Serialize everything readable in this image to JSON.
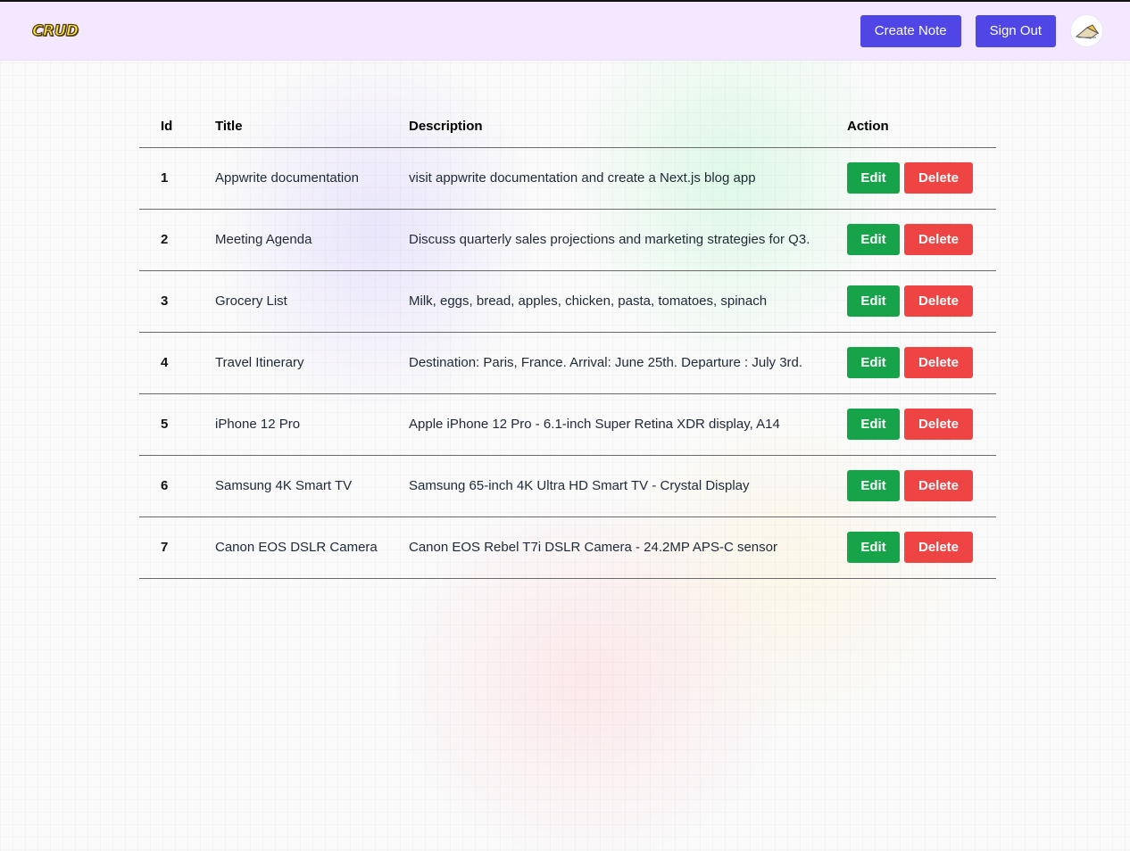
{
  "header": {
    "logo_text": "CRUD",
    "create_note_label": "Create Note",
    "sign_out_label": "Sign Out",
    "avatar_icon": "user-avatar-icon"
  },
  "table": {
    "columns": [
      "Id",
      "Title",
      "Description",
      "Action"
    ],
    "rows": [
      {
        "id": "1",
        "title": "Appwrite documentation",
        "description": "visit appwrite documentation and create a Next.js blog app"
      },
      {
        "id": "2",
        "title": "Meeting Agenda",
        "description": "Discuss quarterly sales projections and marketing strategies for Q3."
      },
      {
        "id": "3",
        "title": "Grocery List",
        "description": "Milk, eggs, bread, apples, chicken, pasta, tomatoes, spinach"
      },
      {
        "id": "4",
        "title": "Travel Itinerary",
        "description": "Destination: Paris, France. Arrival: June 25th. Departure : July 3rd."
      },
      {
        "id": "5",
        "title": "iPhone 12 Pro",
        "description": "Apple iPhone 12 Pro - 6.1-inch Super Retina XDR display, A14"
      },
      {
        "id": "6",
        "title": "Samsung 4K Smart TV",
        "description": "Samsung 65-inch 4K Ultra HD Smart TV - Crystal Display"
      },
      {
        "id": "7",
        "title": "Canon EOS DSLR Camera",
        "description": "Canon EOS Rebel T7i DSLR Camera - 24.2MP APS-C sensor"
      }
    ],
    "edit_label": "Edit",
    "delete_label": "Delete"
  },
  "colors": {
    "header_bg": "#f3e8ff",
    "primary_button": "#4f46e5",
    "edit_button": "#16a34a",
    "delete_button": "#ef4444"
  }
}
